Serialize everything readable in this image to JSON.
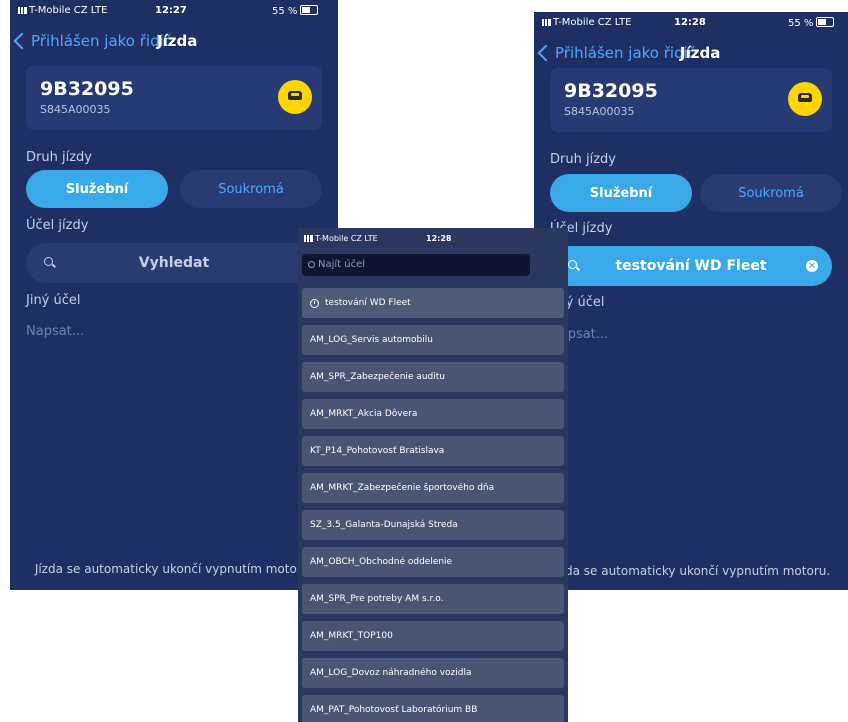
{
  "left": {
    "status": {
      "carrier": "T-Mobile CZ  LTE",
      "time": "12:27",
      "battery": "55 %"
    },
    "nav": {
      "back_label": "Přihlášen jako řidič",
      "title": "Jízda"
    },
    "vehicle": {
      "plate": "9B32095",
      "vin": "S845A00035"
    },
    "trip_type_label": "Druh jízdy",
    "trip_type_options": [
      "Služební",
      "Soukromá"
    ],
    "purpose_label": "Účel jízdy",
    "search_placeholder": "Vyhledat",
    "other_purpose_label": "Jiný účel",
    "other_purpose_placeholder": "Napsat...",
    "footer_note": "Jízda se automaticky ukončí vypnutím motoru."
  },
  "right": {
    "status": {
      "carrier": "T-Mobile CZ  LTE",
      "time": "12:28",
      "battery": "55 %"
    },
    "nav": {
      "back_label": "Přihlášen jako řidič",
      "title": "Jízda"
    },
    "vehicle": {
      "plate": "9B32095",
      "vin": "S845A00035"
    },
    "trip_type_label": "Druh jízdy",
    "trip_type_options": [
      "Služební",
      "Soukromá"
    ],
    "purpose_label": "Účel jízdy",
    "search_value": "testování WD Fleet",
    "other_purpose_label": "Jiný účel",
    "other_purpose_placeholder": "Napsat...",
    "footer_note": "Jízda se automaticky ukončí vypnutím motoru."
  },
  "middle": {
    "status": {
      "carrier": "T-Mobile CZ  LTE",
      "time": "12:28"
    },
    "filter_placeholder": "Najít účel",
    "recent_item": "testování WD Fleet",
    "items": [
      "AM_LOG_Servis automobilu",
      "AM_SPR_Zabezpečenie auditu",
      "AM_MRKT_Akcia Dôvera",
      "KT_P14_Pohotovosť Bratislava",
      "AM_MRKT_Zabezpečenie športového dňa",
      "SZ_3.5_Galanta-Dunajská Streda",
      "AM_OBCH_Obchodné oddelenie",
      "AM_SPR_Pre potreby AM s.r.o.",
      "AM_MRKT_TOP100",
      "AM_LOG_Dovoz náhradného vozidla",
      "AM_PAT_Pohotovosť Laboratórium BB"
    ]
  },
  "colors": {
    "background": "#1f2f63",
    "accent": "#3aa9ea",
    "link": "#4aa8ff",
    "car_button": "#ffd500"
  }
}
